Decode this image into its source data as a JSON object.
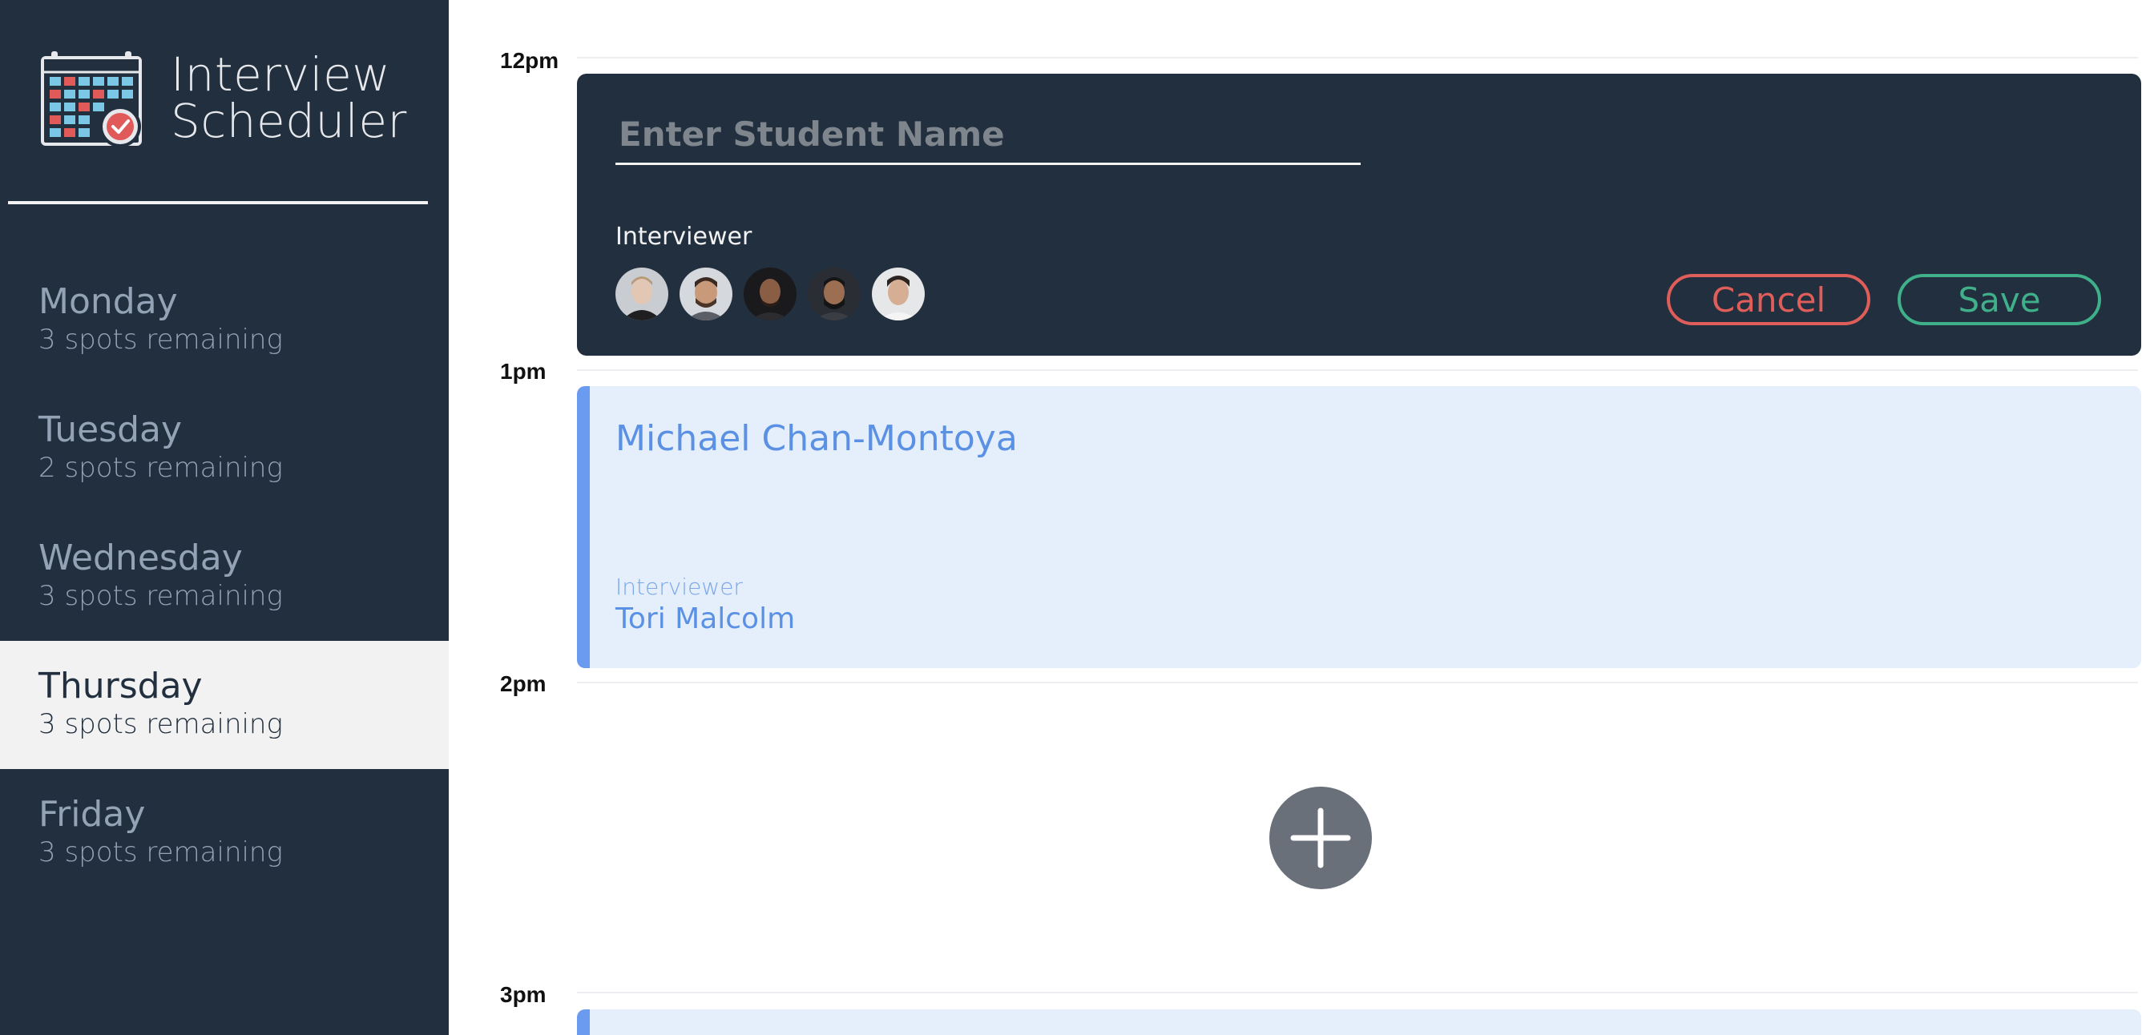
{
  "app": {
    "title_line1": "Interview",
    "title_line2": "Scheduler",
    "logo_icon": "calendar-check-icon"
  },
  "days": [
    {
      "name": "Monday",
      "spots": "3 spots remaining",
      "selected": false
    },
    {
      "name": "Tuesday",
      "spots": "2 spots remaining",
      "selected": false
    },
    {
      "name": "Wednesday",
      "spots": "3 spots remaining",
      "selected": false
    },
    {
      "name": "Thursday",
      "spots": "3 spots remaining",
      "selected": true
    },
    {
      "name": "Friday",
      "spots": "3 spots remaining",
      "selected": false
    }
  ],
  "hours": [
    "12pm",
    "1pm",
    "2pm",
    "3pm"
  ],
  "form": {
    "student_value": "",
    "student_placeholder": "Enter Student Name",
    "interviewer_label": "Interviewer",
    "interviewer_avatar_count": 5,
    "cancel_label": "Cancel",
    "save_label": "Save"
  },
  "booked": {
    "student": "Michael Chan-Montoya",
    "interviewer_label": "Interviewer",
    "interviewer_name": "Tori Malcolm"
  },
  "add_icon": "plus-icon",
  "colors": {
    "sidebar_bg": "#222f3e",
    "selected_day_bg": "#f2f2f2",
    "cancel": "#df5e5a",
    "save": "#3fb089",
    "booked_bg": "#e5eefb",
    "booked_accent": "#6b9bf0",
    "add_button": "#6a7079"
  }
}
